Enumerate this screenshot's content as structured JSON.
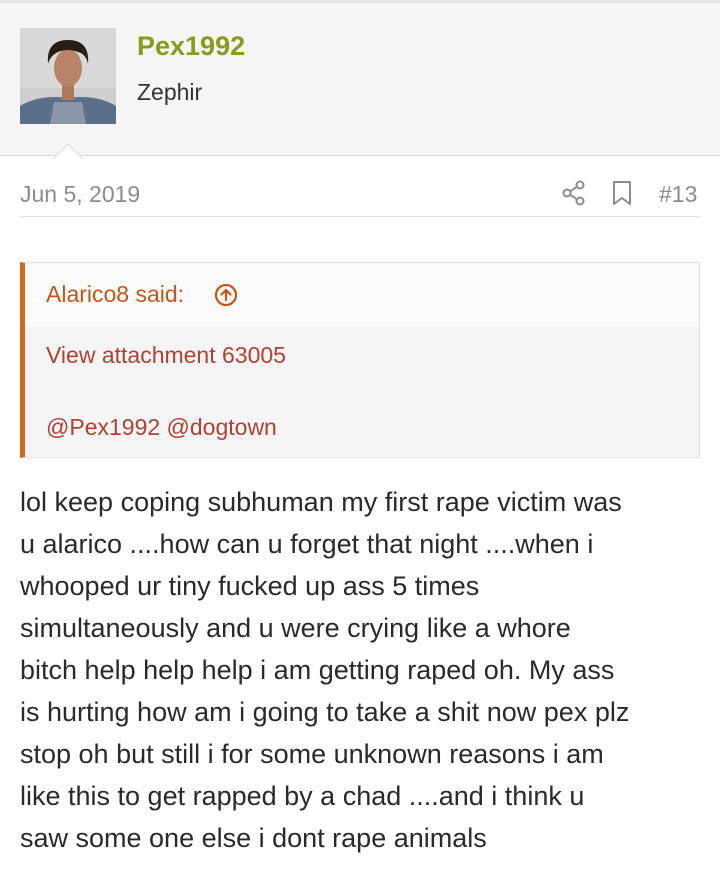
{
  "user": {
    "name": "Pex1992",
    "title": "Zephir"
  },
  "post": {
    "date": "Jun 5, 2019",
    "number": "#13",
    "quote": {
      "author": "Alarico8 said:",
      "attachment": "View attachment 63005",
      "mentions": "@Pex1992 @dogtown"
    },
    "body_lines": [
      "lol keep coping subhuman my first rape victim was",
      "u alarico ....how can u forget that night ....when i",
      "whooped ur tiny fucked up ass 5 times",
      "simultaneously and u were crying like a whore",
      "bitch help help help i am getting raped oh. My ass",
      "is hurting how am i going to take a shit now pex plz",
      "stop oh but still i for some unknown reasons i am",
      "like this to get rapped by a chad ....and i think u",
      "saw some one else i dont rape animals"
    ]
  },
  "icons": {
    "share": "share-icon",
    "bookmark": "bookmark-icon",
    "quote_jump": "arrow-up-circle-icon"
  },
  "colors": {
    "username": "#8a9a1a",
    "quote_accent": "#d2691e",
    "quote_link": "#b34032"
  }
}
